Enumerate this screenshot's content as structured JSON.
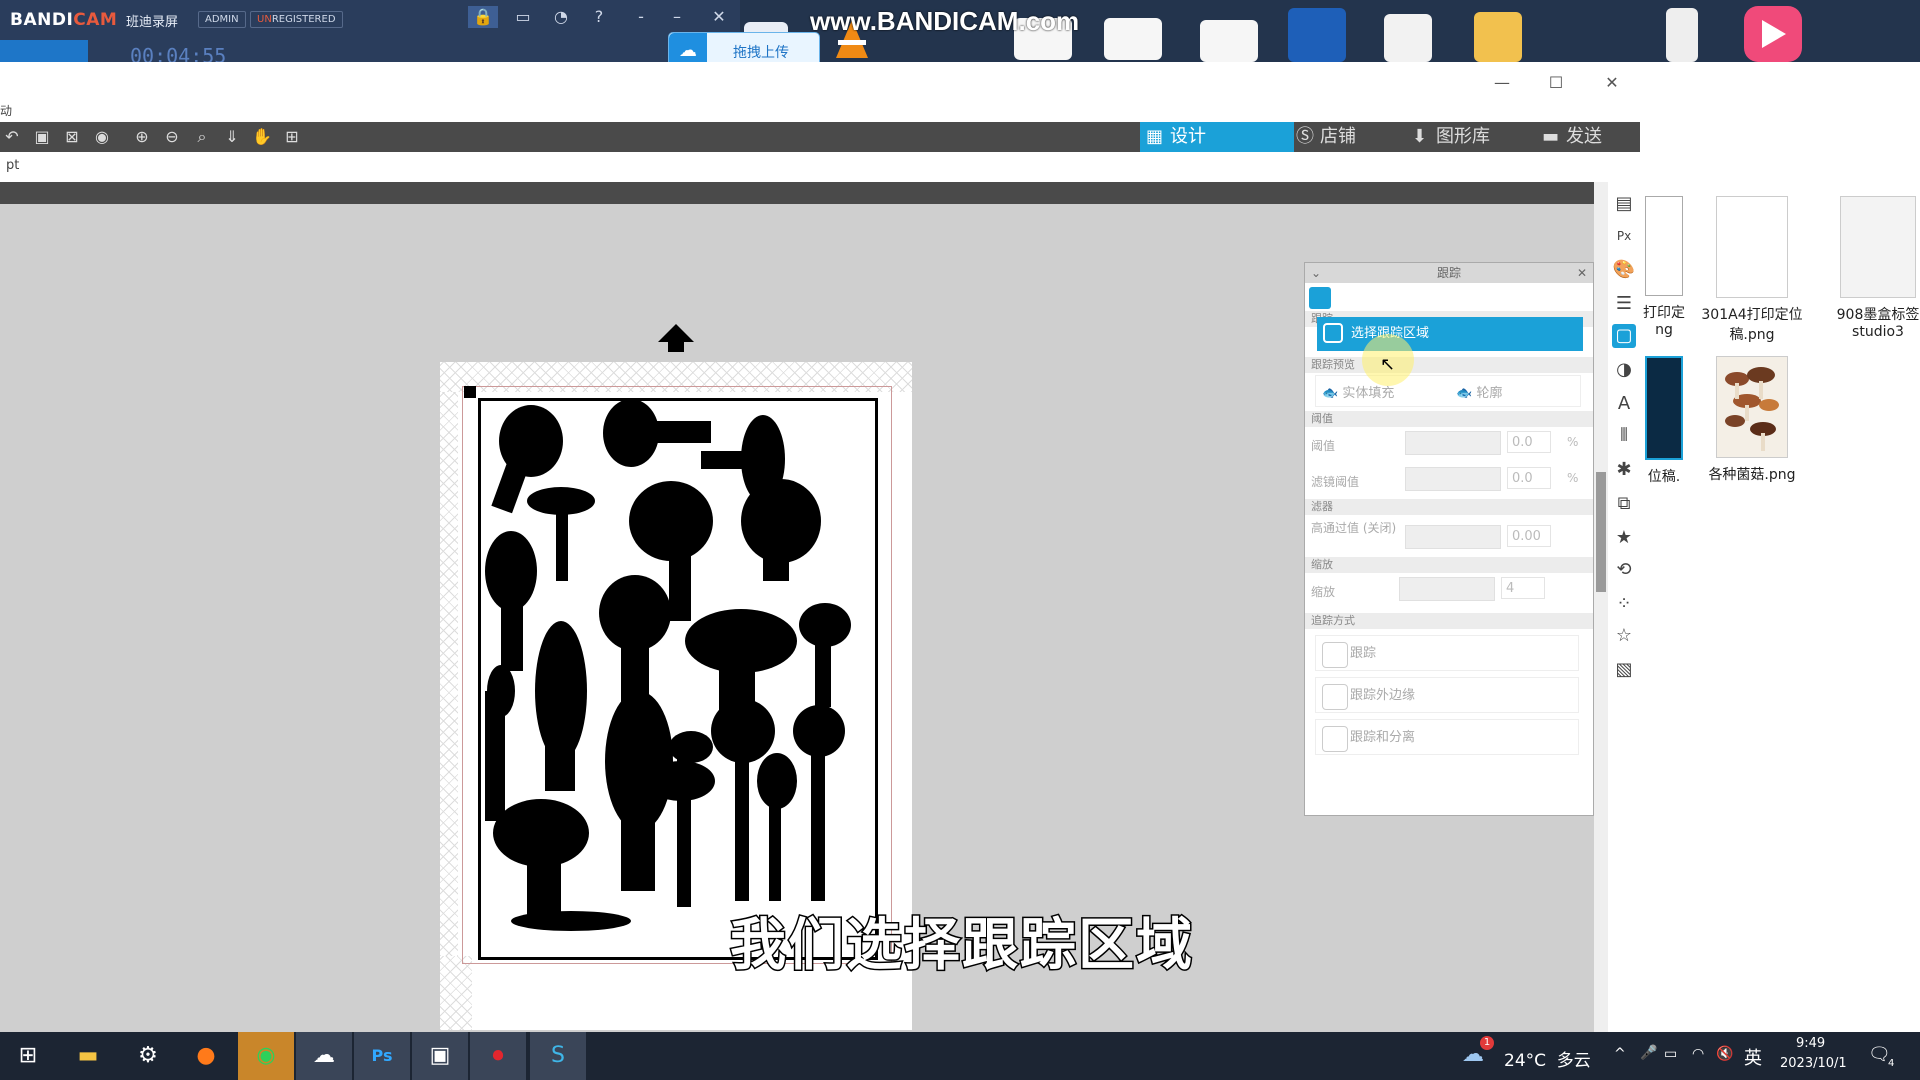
{
  "bandicam": {
    "brand_prefix": "BANDI",
    "brand_suffix": "CAM",
    "cn_name": "班迪录屏",
    "admin_tag": "ADMIN",
    "unregistered_prefix": "UN",
    "unregistered_suffix": "REGISTERED",
    "timer": "00:04:55",
    "watermark": "www.BANDICAM.com"
  },
  "upload_button": {
    "label": "拖拽上传"
  },
  "window": {
    "title_fragment": "动",
    "unit_label": "pt",
    "tabs": [
      {
        "label": "设计",
        "icon": "grid-icon"
      },
      {
        "label": "店铺",
        "icon": "s-icon"
      },
      {
        "label": "图形库",
        "icon": "download-icon"
      },
      {
        "label": "发送",
        "icon": "printer-icon"
      }
    ]
  },
  "trace_panel": {
    "title": "跟踪",
    "section_trace": "跟踪",
    "select_area_label": "选择跟踪区域",
    "section_preview": "跟踪预览",
    "preview_fill": "实体填充",
    "preview_outline": "轮廓",
    "section_threshold": "阈值",
    "threshold_label": "阈值",
    "threshold_value": "0.0",
    "threshold_unit": "%",
    "filter_threshold_label": "滤镜阈值",
    "filter_threshold_value": "0.0",
    "filter_threshold_unit": "%",
    "section_filter": "滤器",
    "highpass_label": "高通过值 (关闭)",
    "highpass_value": "0.00",
    "section_scale": "缩放",
    "scale_label": "缩放",
    "scale_value": "4",
    "section_method": "追踪方式",
    "method_trace": "跟踪",
    "method_outer": "跟踪外边缘",
    "method_separate": "跟踪和分离"
  },
  "desktop_files": [
    {
      "label": "打印定\nng"
    },
    {
      "label": "301A4打印定位\n稿.png"
    },
    {
      "label": "908墨盒标签\nstudio3"
    },
    {
      "label": "位稿."
    },
    {
      "label": "各种菌菇.png"
    }
  ],
  "subtitle": "我们选择跟踪区域",
  "taskbar": {
    "weather": "24°C  多云",
    "weather_badge": "1",
    "ime": "英",
    "time": "9:49",
    "date": "2023/10/1",
    "notifications": "4"
  }
}
